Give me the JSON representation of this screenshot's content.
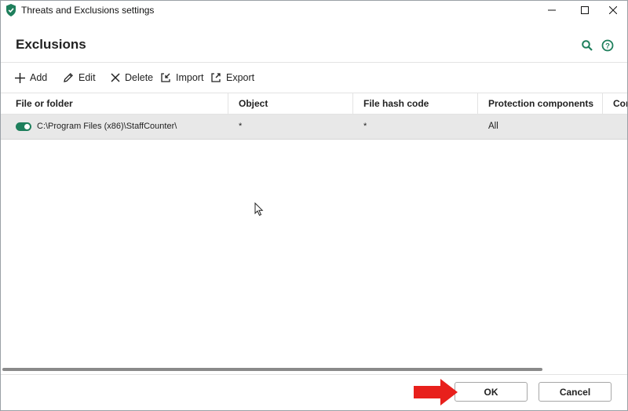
{
  "window": {
    "title": "Threats and Exclusions settings",
    "icon": "kaspersky-shield-icon"
  },
  "header": {
    "title": "Exclusions",
    "search_icon": "search-icon",
    "help_icon": "help-icon"
  },
  "toolbar": {
    "add": "Add",
    "edit": "Edit",
    "delete": "Delete",
    "import": "Import",
    "export": "Export"
  },
  "table": {
    "columns": [
      "File or folder",
      "Object",
      "File hash code",
      "Protection components",
      "Con"
    ],
    "rows": [
      {
        "enabled": true,
        "file": "C:\\Program Files (x86)\\StaffCounter\\",
        "object": "*",
        "hash": "*",
        "protection": "All"
      }
    ]
  },
  "footer": {
    "ok": "OK",
    "cancel": "Cancel"
  },
  "colors": {
    "accent_green": "#1e7f5c",
    "annotation_red": "#e8201c",
    "selected_row": "#e8e8e8"
  }
}
